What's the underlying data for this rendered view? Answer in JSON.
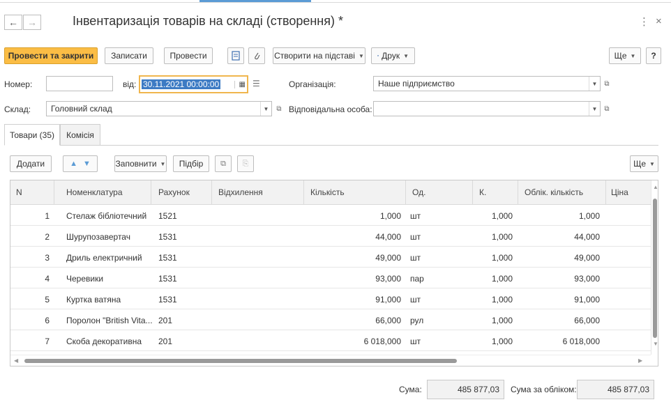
{
  "header": {
    "title": "Інвентаризація товарів на складі (створення) *",
    "back_icon": "←",
    "forward_icon": "→",
    "more_icon": "⋮",
    "close_icon": "×"
  },
  "toolbar": {
    "post_close": "Провести та закрити",
    "save": "Записати",
    "post": "Провести",
    "create_based": "Створити на підставі",
    "print": "Друк",
    "more": "Ще",
    "help": "?"
  },
  "form": {
    "number_label": "Номер:",
    "number_value": "",
    "date_label": "від:",
    "date_value": "30.11.2021 00:00:00",
    "org_label": "Організація:",
    "org_value": "Наше підприємство",
    "warehouse_label": "Склад:",
    "warehouse_value": "Головний склад",
    "responsible_label": "Відповідальна особа:",
    "responsible_value": ""
  },
  "tabs": [
    {
      "label": "Товари (35)",
      "active": true
    },
    {
      "label": "Комісія",
      "active": false
    }
  ],
  "grid_toolbar": {
    "add": "Додати",
    "fill": "Заповнити",
    "select": "Підбір",
    "more": "Ще"
  },
  "grid": {
    "columns": [
      "N",
      "Номенклатура",
      "Рахунок",
      "Відхилення",
      "Кількість",
      "Од.",
      "К.",
      "Облік. кількість",
      "Ціна"
    ],
    "rows": [
      [
        "1",
        "Стелаж бібліотечний",
        "1521",
        "",
        "1,000",
        "шт",
        "1,000",
        "1,000",
        ""
      ],
      [
        "2",
        "Шурупозавертач",
        "1531",
        "",
        "44,000",
        "шт",
        "1,000",
        "44,000",
        ""
      ],
      [
        "3",
        "Дриль електричний",
        "1531",
        "",
        "49,000",
        "шт",
        "1,000",
        "49,000",
        ""
      ],
      [
        "4",
        "Черевики",
        "1531",
        "",
        "93,000",
        "пар",
        "1,000",
        "93,000",
        ""
      ],
      [
        "5",
        "Куртка ватяна",
        "1531",
        "",
        "91,000",
        "шт",
        "1,000",
        "91,000",
        ""
      ],
      [
        "6",
        "Поролон \"British Vita...",
        "201",
        "",
        "66,000",
        "рул",
        "1,000",
        "66,000",
        ""
      ],
      [
        "7",
        "Скоба декоративна",
        "201",
        "",
        "6 018,000",
        "шт",
        "1,000",
        "6 018,000",
        ""
      ]
    ]
  },
  "footer": {
    "sum_label": "Сума:",
    "sum_value": "485 877,03",
    "sum_accounting_label": "Сума за обліком:",
    "sum_accounting_value": "485 877,03"
  },
  "colors": {
    "primary_button": "#fbbd45",
    "focus_border": "#f0b64d",
    "selection": "#3d7bc4",
    "arrow_blue": "#5b9bd5"
  }
}
